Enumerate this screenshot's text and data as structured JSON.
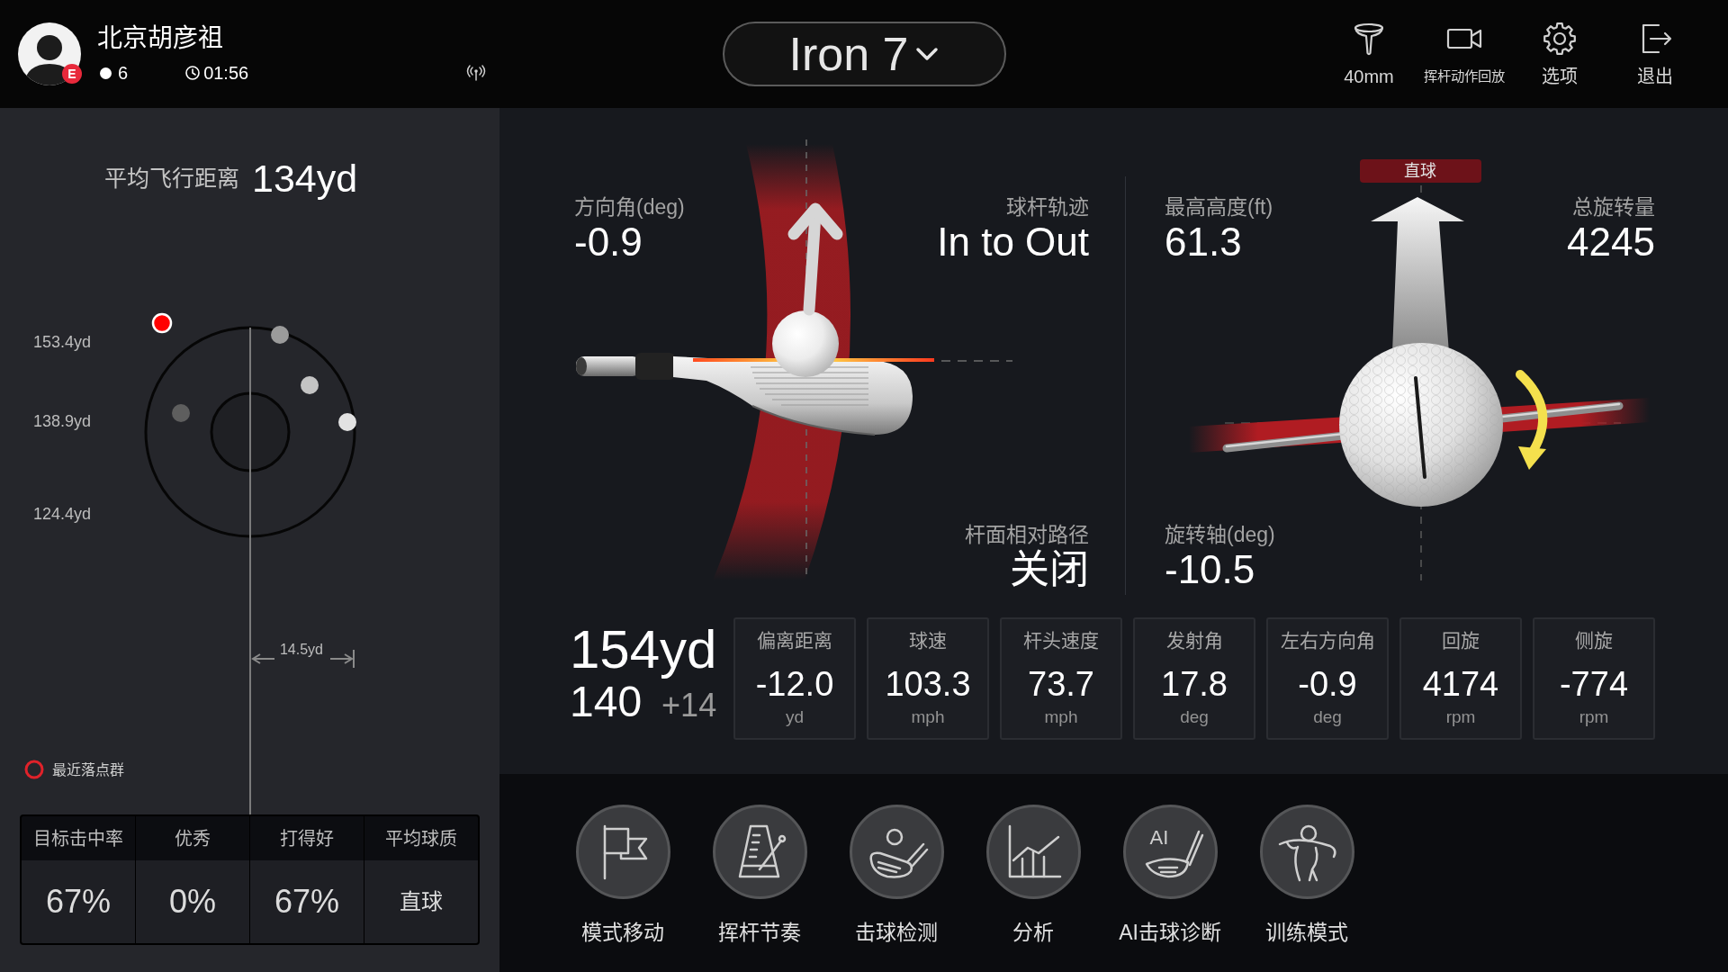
{
  "header": {
    "player_name": "北京胡彦祖",
    "level_badge": "E",
    "ball_count": "6",
    "session_time": "01:56"
  },
  "club_selector": {
    "value": "Iron 7"
  },
  "toolbar": [
    {
      "kind": "tee",
      "label": "40mm"
    },
    {
      "kind": "camera",
      "label": "挥杆动作回放"
    },
    {
      "kind": "settings",
      "label": "选项"
    },
    {
      "kind": "exit",
      "label": "退出"
    }
  ],
  "dispersion": {
    "title": "平均飞行距离",
    "average": "134yd",
    "distance_labels": [
      "153.4yd",
      "138.9yd",
      "124.4yd"
    ],
    "spread_label": "14.5yd",
    "legend": "最近落点群",
    "shots": [
      {
        "color": "#ff0000"
      },
      {
        "color": "#9b9b9b"
      },
      {
        "color": "#c4c4c4"
      },
      {
        "color": "#e2e2e2"
      },
      {
        "color": "#5e5e5e"
      }
    ]
  },
  "stats": [
    {
      "kind": "number",
      "label": "目标击中率",
      "value": "67%"
    },
    {
      "kind": "number",
      "label": "优秀",
      "value": "0%"
    },
    {
      "kind": "number",
      "label": "打得好",
      "value": "67%"
    },
    {
      "kind": "text",
      "label": "平均球质",
      "value": "直球"
    }
  ],
  "club_view": {
    "face_angle_label": "方向角(deg)",
    "face_angle": "-0.9",
    "path_label": "球杆轨迹",
    "path": "In to Out",
    "face_to_path_label": "杆面相对路径",
    "face_to_path": "关闭"
  },
  "ball_view": {
    "shot_shape": "直球",
    "apex_label": "最高高度(ft)",
    "apex": "61.3",
    "total_spin_label": "总旋转量",
    "total_spin": "4245",
    "spin_axis_label": "旋转轴(deg)",
    "spin_axis": "-10.5"
  },
  "distance": {
    "total": "154yd",
    "carry": "140",
    "difference": "+14"
  },
  "metrics": [
    {
      "label": "偏离距离",
      "value": "-12.0",
      "unit": "yd"
    },
    {
      "label": "球速",
      "value": "103.3",
      "unit": "mph"
    },
    {
      "label": "杆头速度",
      "value": "73.7",
      "unit": "mph"
    },
    {
      "label": "发射角",
      "value": "17.8",
      "unit": "deg"
    },
    {
      "label": "左右方向角",
      "value": "-0.9",
      "unit": "deg"
    },
    {
      "label": "回旋",
      "value": "4174",
      "unit": "rpm"
    },
    {
      "label": "侧旋",
      "value": "-774",
      "unit": "rpm"
    }
  ],
  "menu": [
    {
      "kind": "flag",
      "label": "模式移动"
    },
    {
      "kind": "metronome",
      "label": "挥杆节奏"
    },
    {
      "kind": "club_ball",
      "label": "击球检测"
    },
    {
      "kind": "chart",
      "label": "分析"
    },
    {
      "kind": "ai",
      "icon_text": "AI",
      "label": "AI击球诊断"
    },
    {
      "kind": "golfer",
      "label": "训练模式"
    }
  ]
}
